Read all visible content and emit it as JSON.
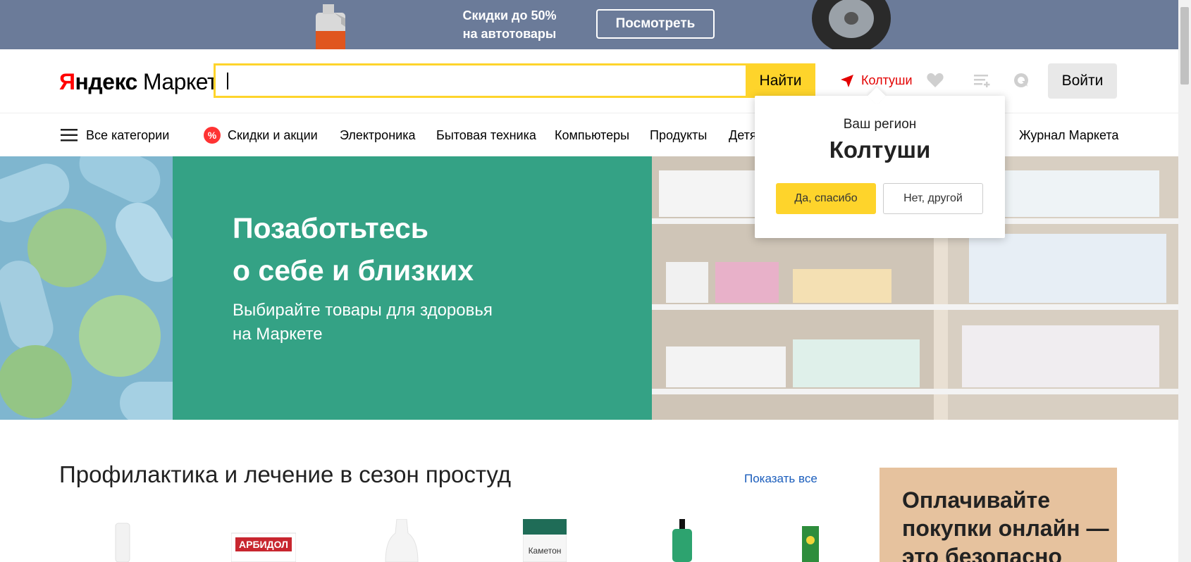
{
  "promo": {
    "text_line1": "Скидки до 50%",
    "text_line2": "на автотовары",
    "button_label": "Посмотреть",
    "bg_color": "#6b7b99"
  },
  "header": {
    "logo_ya_first": "Я",
    "logo_ya_rest": "ндекс",
    "logo_market": "Маркет",
    "search_placeholder": "",
    "search_button": "Найти",
    "region_label": "Колтуши",
    "login_button": "Войти",
    "icons": [
      "location-arrow-icon",
      "heart-icon",
      "compare-list-icon",
      "orders-icon"
    ],
    "accent_color": "#fed42b",
    "region_color": "#e30000"
  },
  "nav": {
    "all_categories": "Все категории",
    "items": [
      "Скидки и акции",
      "Электроника",
      "Бытовая техника",
      "Компьютеры",
      "Продукты",
      "Детя",
      "Журнал Маркета"
    ],
    "discount_badge": "%"
  },
  "hero": {
    "title_line1": "Позаботьтесь",
    "title_line2": "о себе и близких",
    "subtitle_line1": "Выбирайте товары для здоровья",
    "subtitle_line2": "на Маркете",
    "bg_color": "#34a285"
  },
  "region_popup": {
    "title": "Ваш регион",
    "city": "Колтуши",
    "confirm_button": "Да, спасибо",
    "decline_button": "Нет, другой"
  },
  "section": {
    "title": "Профилактика и лечение в сезон простуд",
    "show_all": "Показать все",
    "products": [
      {
        "label": ""
      },
      {
        "label": "АРБИДОЛ"
      },
      {
        "label": ""
      },
      {
        "label": "Каметон"
      },
      {
        "label": ""
      },
      {
        "label": ""
      }
    ]
  },
  "pay_card": {
    "line1": "Оплачивайте",
    "line2": "покупки онлайн —",
    "line3": "это безопасно"
  }
}
